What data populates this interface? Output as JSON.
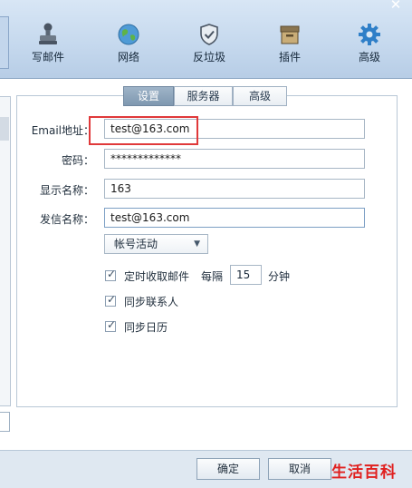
{
  "toolbar": {
    "close_glyph": "✕",
    "items": [
      {
        "label": "写邮件",
        "icon": "stamp-icon"
      },
      {
        "label": "网络",
        "icon": "globe-icon"
      },
      {
        "label": "反垃圾",
        "icon": "shield-icon"
      },
      {
        "label": "插件",
        "icon": "box-icon"
      },
      {
        "label": "高级",
        "icon": "gear-icon"
      }
    ]
  },
  "tabs": [
    {
      "label": "设置",
      "active": true
    },
    {
      "label": "服务器",
      "active": false
    },
    {
      "label": "高级",
      "active": false
    }
  ],
  "form": {
    "email_label": "Email地址：",
    "email_value": "test@163.com",
    "password_label": "密码：",
    "password_value": "*************",
    "display_name_label": "显示名称：",
    "display_name_value": "163",
    "sender_name_label": "发信名称：",
    "sender_name_value": "test@163.com",
    "account_status_value": "帐号活动",
    "auto_receive_label": "定时收取邮件",
    "auto_receive_checked": true,
    "interval_prefix": "每隔",
    "interval_value": "15",
    "interval_unit": "分钟",
    "sync_contacts_label": "同步联系人",
    "sync_contacts_checked": true,
    "sync_calendar_label": "同步日历",
    "sync_calendar_checked": true
  },
  "footer": {
    "ok_label": "确定",
    "cancel_label": "取消",
    "watermark": "生活百科"
  },
  "colors": {
    "highlight_box": "#e0393a",
    "watermark": "#e0201f",
    "active_tab": "#8aa1b8"
  }
}
